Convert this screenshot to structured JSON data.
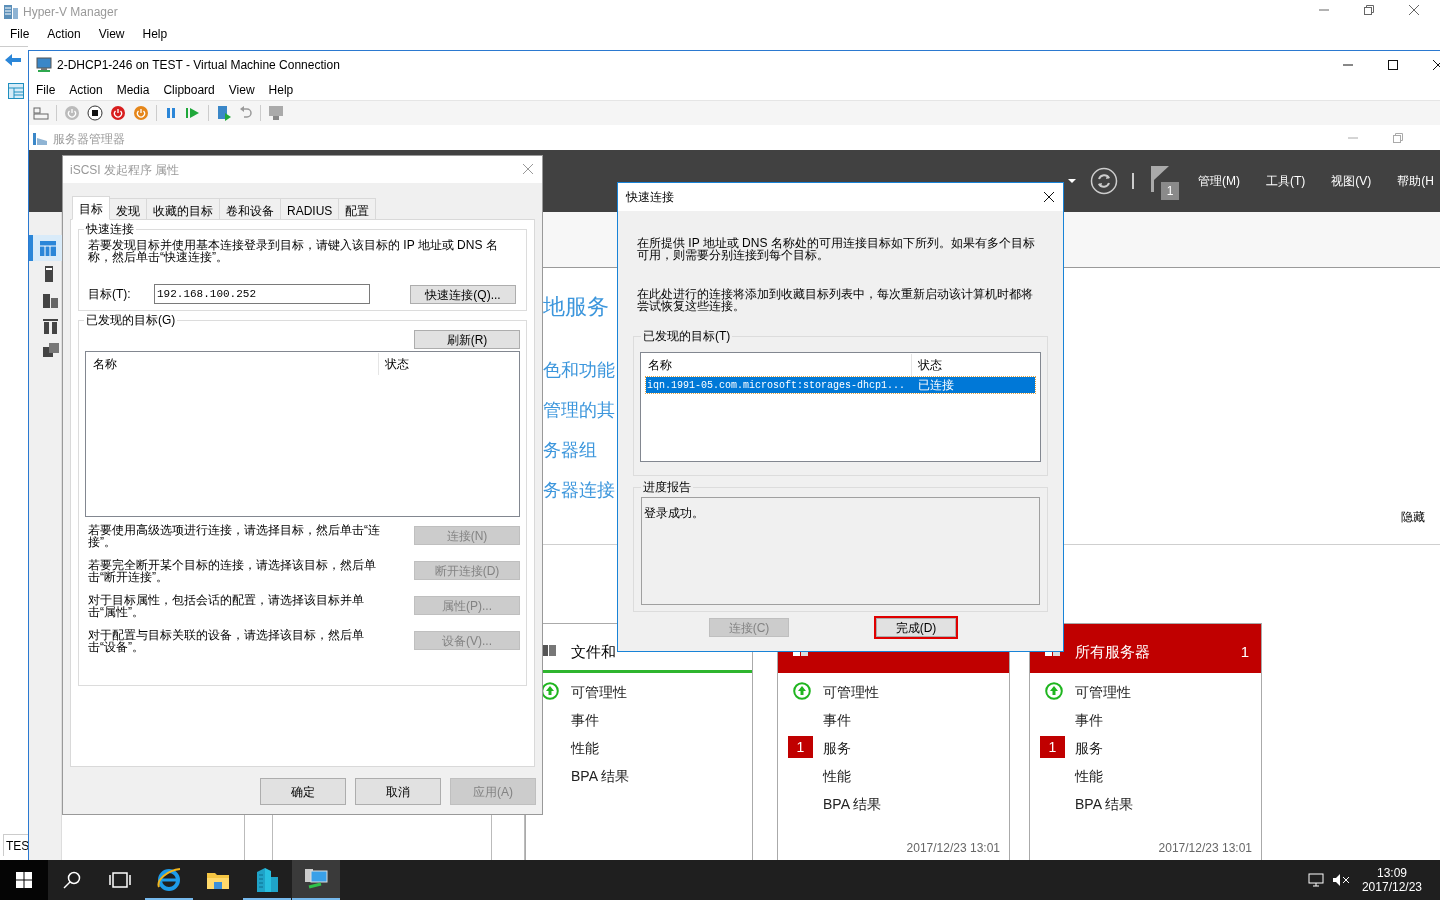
{
  "hyperv_manager": {
    "title": "Hyper-V Manager",
    "menu": [
      "File",
      "Action",
      "View",
      "Help"
    ],
    "status_text": "TES"
  },
  "vm_connection": {
    "title": "2-DHCP1-246 on TEST - Virtual Machine Connection",
    "menu": [
      "File",
      "Action",
      "Media",
      "Clipboard",
      "View",
      "Help"
    ]
  },
  "server_manager": {
    "title": "服务器管理器",
    "header_menu": [
      "管理(M)",
      "工具(T)",
      "视图(V)",
      "帮助(H"
    ],
    "notification_count": "1",
    "welcome_links": [
      "地服务",
      "色和功能",
      "管理的其",
      "务器组",
      "务器连接"
    ],
    "hide_link": "隐藏",
    "tiles": [
      {
        "title": "文件和",
        "error": false,
        "items": [
          {
            "label": "可管理性",
            "kind": "status"
          },
          {
            "label": "事件",
            "kind": "plain"
          },
          {
            "label": "性能",
            "kind": "plain"
          },
          {
            "label": "BPA 结果",
            "kind": "plain"
          }
        ]
      },
      {
        "error": true,
        "timestamp": "2017/12/23 13:01",
        "items": [
          {
            "label": "可管理性",
            "kind": "status"
          },
          {
            "label": "事件",
            "kind": "plain"
          },
          {
            "label": "服务",
            "kind": "alert",
            "badge": "1"
          },
          {
            "label": "性能",
            "kind": "plain"
          },
          {
            "label": "BPA 结果",
            "kind": "plain"
          }
        ]
      },
      {
        "title": "所有服务器",
        "count": "1",
        "error": true,
        "timestamp": "2017/12/23 13:01",
        "items": [
          {
            "label": "可管理性",
            "kind": "status"
          },
          {
            "label": "事件",
            "kind": "plain"
          },
          {
            "label": "服务",
            "kind": "alert",
            "badge": "1"
          },
          {
            "label": "性能",
            "kind": "plain"
          },
          {
            "label": "BPA 结果",
            "kind": "plain"
          }
        ]
      }
    ]
  },
  "iscsi_dialog": {
    "title": "iSCSI 发起程序 属性",
    "tabs": [
      {
        "label": "目标",
        "selected": true
      },
      {
        "label": "发现",
        "selected": false
      },
      {
        "label": "收藏的目标",
        "selected": false
      },
      {
        "label": "卷和设备",
        "selected": false
      },
      {
        "label": "RADIUS",
        "selected": false
      },
      {
        "label": "配置",
        "selected": false
      }
    ],
    "quick_connect": {
      "group_label": "快速连接",
      "instructions": "若要发现目标并使用基本连接登录到目标，请键入该目标的 IP 地址或 DNS 名称，然后单击“快速连接”。",
      "target_label": "目标(T):",
      "target_value": "192.168.100.252",
      "button": "快速连接(Q)..."
    },
    "discovered": {
      "group_label": "已发现的目标(G)",
      "refresh_button": "刷新(R)",
      "columns": [
        "名称",
        "状态"
      ]
    },
    "actions": [
      {
        "text": "若要使用高级选项进行连接，请选择目标，然后单击“连接”。",
        "button": "连接(N)",
        "disabled": true
      },
      {
        "text": "若要完全断开某个目标的连接，请选择该目标，然后单击“断开连接”。",
        "button": "断开连接(D)",
        "disabled": true
      },
      {
        "text": "对于目标属性，包括会话的配置，请选择该目标并单击“属性”。",
        "button": "属性(P)...",
        "disabled": true
      },
      {
        "text": "对于配置与目标关联的设备，请选择该目标，然后单击“设备”。",
        "button": "设备(V)...",
        "disabled": true
      }
    ],
    "buttons": [
      {
        "label": "确定",
        "disabled": false
      },
      {
        "label": "取消",
        "disabled": false
      },
      {
        "label": "应用(A)",
        "disabled": true
      }
    ]
  },
  "quick_connect_dialog": {
    "title": "快速连接",
    "paragraphs": [
      "在所提供 IP 地址或 DNS 名称处的可用连接目标如下所列。如果有多个目标可用，则需要分别连接到每个目标。",
      "在此处进行的连接将添加到收藏目标列表中，每次重新启动该计算机时都将尝试恢复这些连接。"
    ],
    "targets_label": "已发现的目标(T)",
    "columns": [
      "名称",
      "状态"
    ],
    "targets": [
      {
        "name": "iqn.1991-05.com.microsoft:storages-dhcp1...",
        "status": "已连接",
        "selected": true
      }
    ],
    "progress_label": "进度报告",
    "progress_text": "登录成功。",
    "buttons": [
      {
        "label": "连接(C)",
        "disabled": true,
        "highlighted": false
      },
      {
        "label": "完成(D)",
        "disabled": false,
        "highlighted": true
      }
    ]
  },
  "taskbar": {
    "apps": [
      {
        "kind": "browser",
        "running": true,
        "selected": false
      },
      {
        "kind": "folder",
        "running": false,
        "selected": false
      },
      {
        "kind": "server",
        "running": true,
        "selected": false
      },
      {
        "kind": "vm",
        "running": true,
        "selected": true
      }
    ],
    "time": "13:09",
    "date": "2017/12/23"
  }
}
